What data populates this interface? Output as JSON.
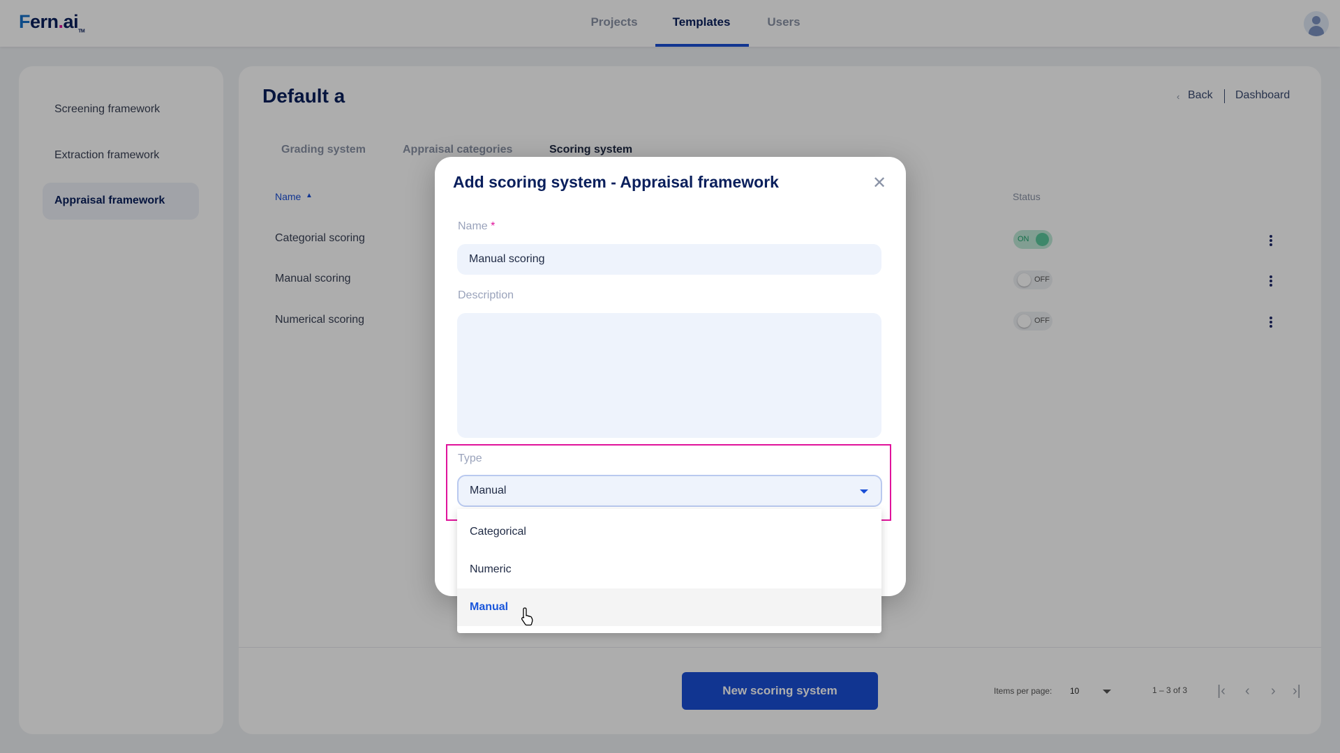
{
  "header": {
    "logo": {
      "f": "F",
      "ern": "ern",
      "dot": ".",
      "ai": "ai",
      "tm": "TM"
    },
    "nav": [
      {
        "label": "Projects"
      },
      {
        "label": "Templates",
        "active": true
      },
      {
        "label": "Users"
      }
    ],
    "avatar_icon": "user-icon"
  },
  "sidebar": {
    "items": [
      {
        "label": "Screening framework"
      },
      {
        "label": "Extraction framework"
      },
      {
        "label": "Appraisal framework",
        "active": true
      }
    ]
  },
  "main": {
    "title": "Default a",
    "back_label": "Back",
    "dashboard_label": "Dashboard",
    "tabs": [
      {
        "label": "Grading system"
      },
      {
        "label": "Appraisal categories"
      },
      {
        "label": "Scoring system",
        "active": true
      }
    ],
    "table": {
      "headers": {
        "name": "Name",
        "status": "Status"
      },
      "rows": [
        {
          "name": "Categorial scoring",
          "status": "ON"
        },
        {
          "name": "Manual scoring",
          "status": "OFF"
        },
        {
          "name": "Numerical scoring",
          "status": "OFF"
        }
      ]
    },
    "new_button": "New scoring system",
    "pagination": {
      "items_per_page_label": "Items per page:",
      "items_per_page": "10",
      "range": "1 – 3 of 3"
    }
  },
  "modal": {
    "title": "Add scoring system - Appraisal framework",
    "name_label": "Name",
    "required_mark": "*",
    "name_value": "Manual scoring",
    "description_label": "Description",
    "description_value": "",
    "type_label": "Type",
    "type_value": "Manual",
    "options": [
      {
        "label": "Categorical"
      },
      {
        "label": "Numeric"
      },
      {
        "label": "Manual",
        "selected": true
      }
    ]
  },
  "colors": {
    "accent": "#1a4fd6",
    "highlight": "#e0139b",
    "on": "#21a36f",
    "navy": "#0a1f5c"
  }
}
